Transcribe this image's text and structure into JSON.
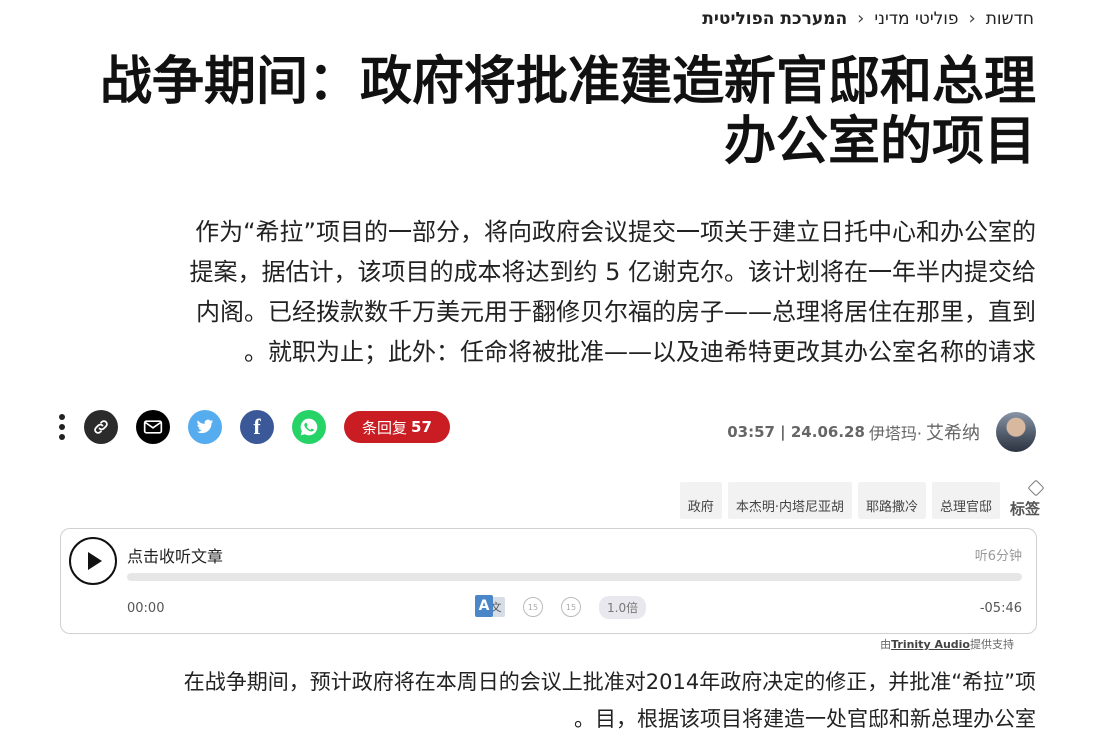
{
  "breadcrumb": {
    "items": [
      "חדשות",
      "פוליטי מדיני",
      "המערכת הפוליטית"
    ]
  },
  "article": {
    "title_line1": "战争期间：政府将批准建造新官邸和总理",
    "title_line2": "办公室的项目",
    "lede": [
      "作为“希拉”项目的一部分，将向政府会议提交一项关于建立日托中心和办公室的",
      "提案，据估计，该项目的成本将达到约 5 亿谢克尔。该计划将在一年半内提交给",
      "内阁。已经拨款数千万美元用于翻修贝尔福的房子——总理将居住在那里，直到",
      "。就职为止；此外：任命将被批准——以及迪希特更改其办公室名称的请求"
    ],
    "body": [
      "在战争期间，预计政府将在本周日的会议上批准对2014年政府决定的修正，并批准“希拉”项",
      "。目，根据该项目将建造一处官邸和新总理办公室"
    ]
  },
  "share": {
    "comments_label": "条回复",
    "comments_count": "57",
    "icons": [
      "more-icon",
      "link-icon",
      "mail-icon",
      "twitter-icon",
      "facebook-icon",
      "whatsapp-icon"
    ]
  },
  "author": {
    "name": "艾希纳",
    "prefix": "伊塔玛·",
    "datetime": "03:57 | 24.06.28"
  },
  "tags": {
    "label": "标签",
    "items": [
      "政府",
      "本杰明·内塔尼亚胡",
      "耶路撒冷",
      "总理官邸"
    ]
  },
  "player": {
    "title": "点击收听文章",
    "duration": "听6分钟",
    "time_start": "00:00",
    "time_end": "-05:46",
    "speed": "1.0倍",
    "translate_a": "A",
    "translate_b": "文",
    "skip_back": "15",
    "skip_fwd": "15"
  },
  "credit": {
    "prefix": "由",
    "brand": "Trinity Audio",
    "suffix": "提供支持"
  },
  "colors": {
    "comments": "#c91d23",
    "twitter": "#55acee",
    "facebook": "#3b5998",
    "whatsapp": "#25d366"
  }
}
